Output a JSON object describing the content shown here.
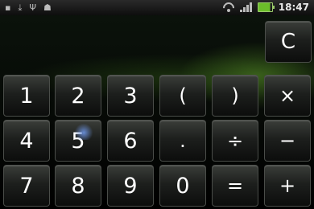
{
  "statusbar": {
    "left_icons": [
      "notification-icon",
      "download-icon",
      "usb-icon",
      "android-icon"
    ],
    "time": "18:47"
  },
  "keypad": {
    "clear": "C",
    "rows": [
      [
        "1",
        "2",
        "3",
        "(",
        ")",
        "×"
      ],
      [
        "4",
        "5",
        "6",
        ".",
        "÷",
        "−"
      ],
      [
        "7",
        "8",
        "9",
        "0",
        "=",
        "+"
      ]
    ]
  }
}
